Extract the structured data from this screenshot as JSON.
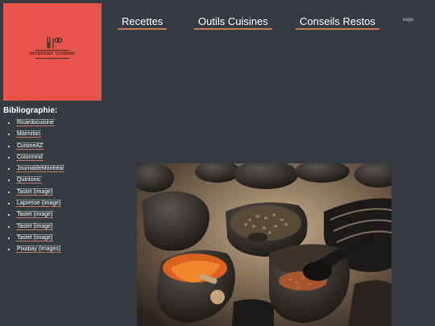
{
  "logo": {
    "text": "INTERNET CUISINE",
    "icon": "fork-knife-icon"
  },
  "nav": {
    "links": [
      "Recettes",
      "Outils Cuisines",
      "Conseils Restos"
    ],
    "small": "expo"
  },
  "biblio": {
    "title": "Bibliographie:",
    "items": [
      "Ricardocuisine",
      "Marmiton",
      "CuisineAZ",
      "Colormind",
      "JournaldeMontréal",
      "Quintonic",
      "Tastet (image)",
      "Lapresse (image)",
      "Tastet (image)",
      "Tastet (image)",
      "Tastet (image)",
      "Pixabay (images)"
    ]
  },
  "colors": {
    "background": "#363b42",
    "logo_bg": "#e8544a",
    "underline": "#c87a5c"
  },
  "photo": {
    "subject": "spice-bowls-image"
  }
}
